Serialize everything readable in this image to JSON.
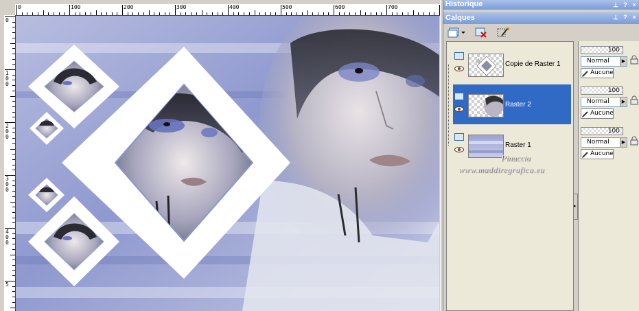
{
  "rulers": {
    "top_labels": [
      "0",
      "100",
      "200",
      "300",
      "400",
      "500",
      "600",
      "700"
    ],
    "left_labels": [
      "0",
      "1\n0\n0",
      "2\n0\n0",
      "3\n0\n0",
      "4\n0\n0",
      "5"
    ]
  },
  "historique": {
    "title": "Historique"
  },
  "calques": {
    "title": "Calques",
    "toolbar": [
      "new-layer-icon",
      "delete-layer-icon",
      "layer-properties-icon"
    ],
    "layers": [
      {
        "name": "Copie de Raster 1",
        "opacity": "100",
        "blend_mode": "Normal",
        "mask": "Aucune",
        "selected": false
      },
      {
        "name": "Raster 2",
        "opacity": "100",
        "blend_mode": "Normal",
        "mask": "Aucune",
        "selected": true
      },
      {
        "name": "Raster 1",
        "opacity": "100",
        "blend_mode": "Normal",
        "mask": "Aucune",
        "selected": false
      }
    ]
  },
  "watermark": {
    "name": "Pinuccia",
    "site": "www.maddiregrafica.eu"
  },
  "colors": {
    "panel_title": "#7a9bd6",
    "selection": "#316ac5",
    "image_bg": "#a4aed8"
  }
}
